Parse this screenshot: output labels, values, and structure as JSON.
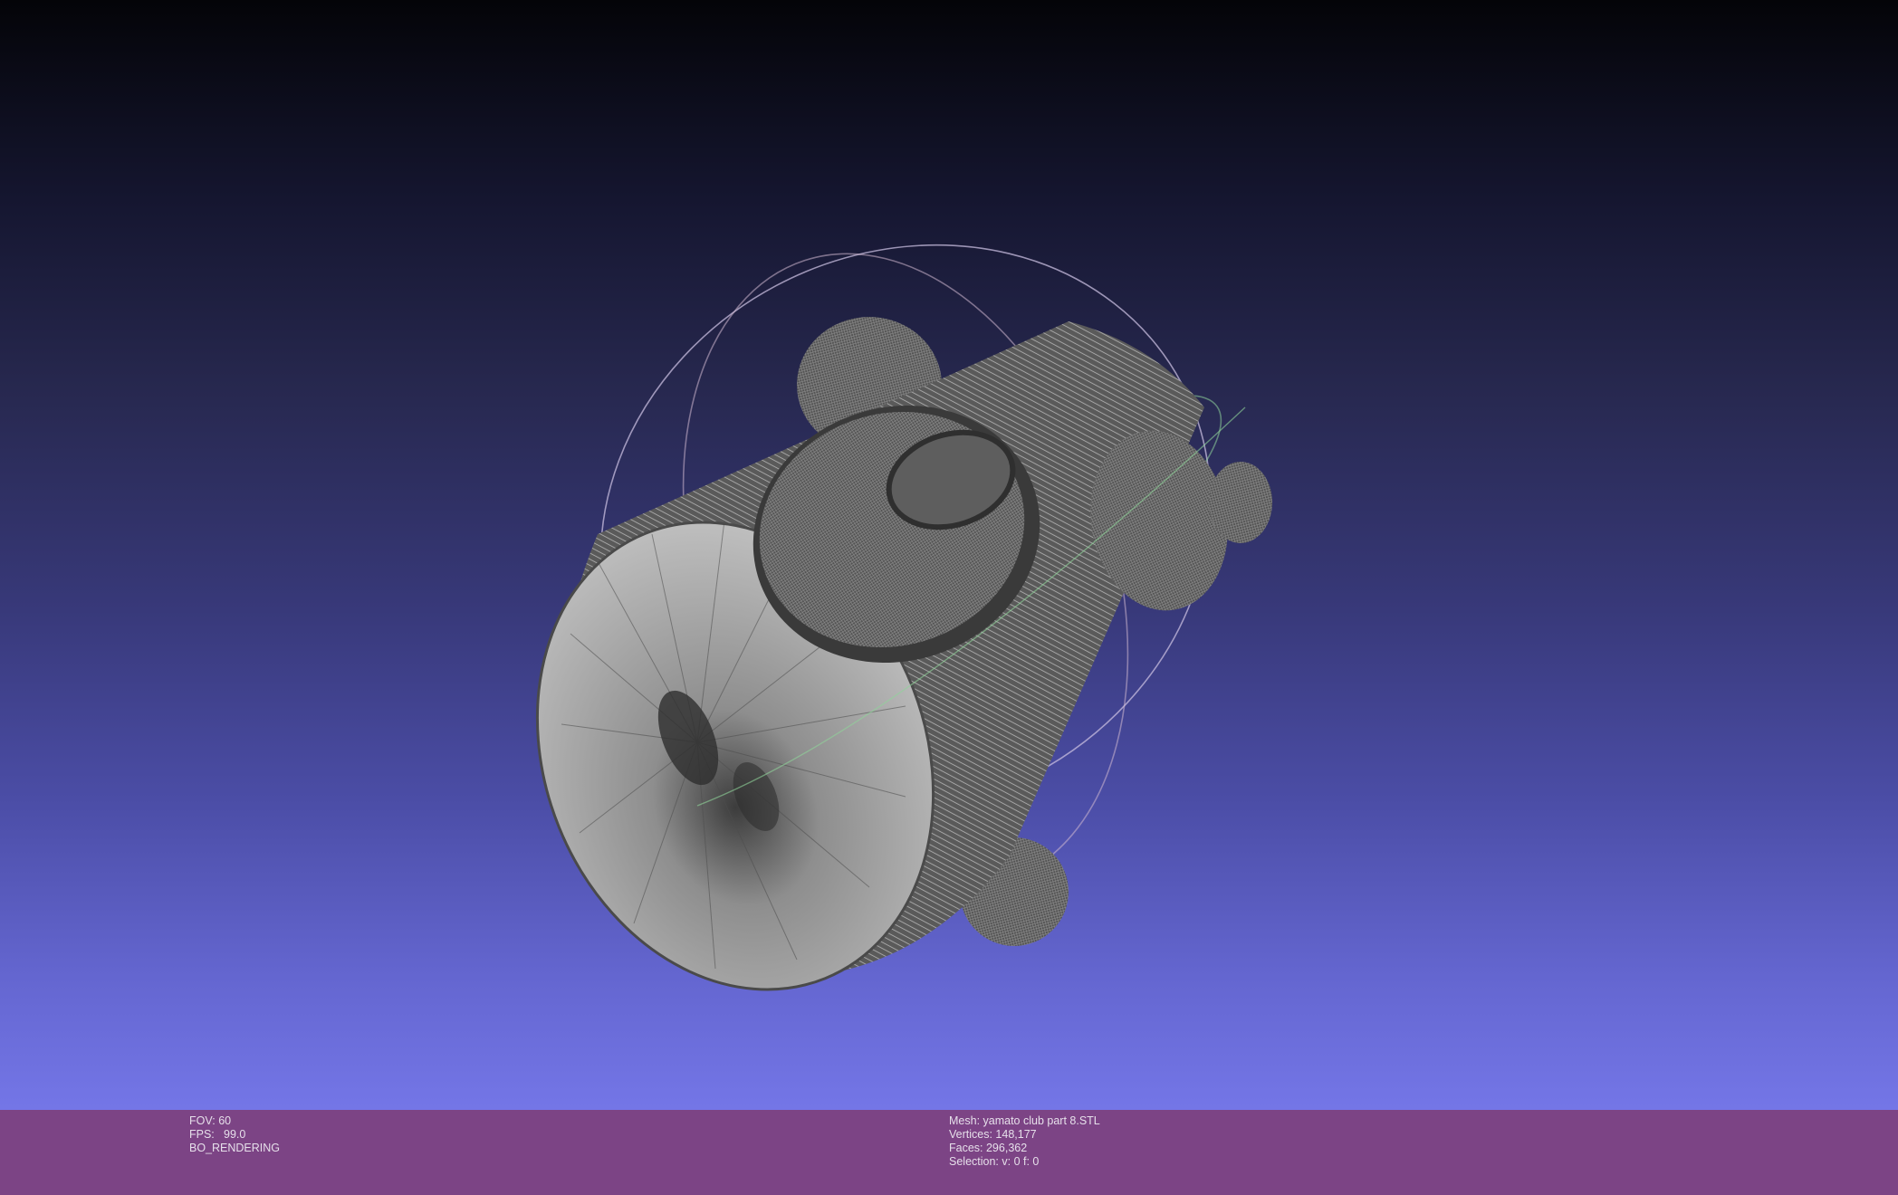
{
  "viewport": {
    "model": "yamato club part 8 mesh (wireframe render)"
  },
  "info_left": {
    "fov_label": "FOV:",
    "fov_value": "60",
    "fps_label": "FPS:",
    "fps_value": "99.0",
    "render_mode": "BO_RENDERING"
  },
  "info_right": {
    "mesh": "Mesh: yamato club part 8.STL",
    "vertices": "Vertices: 148,177",
    "faces": "Faces: 296,362",
    "selection": "Selection: v: 0 f: 0"
  },
  "colors": {
    "info_bar": "#7c4485",
    "mesh": "#6e6e6e",
    "trackball_red": "#c98aa3",
    "trackball_green": "#7fd08a",
    "trackball_blue": "#b9b9f0"
  }
}
